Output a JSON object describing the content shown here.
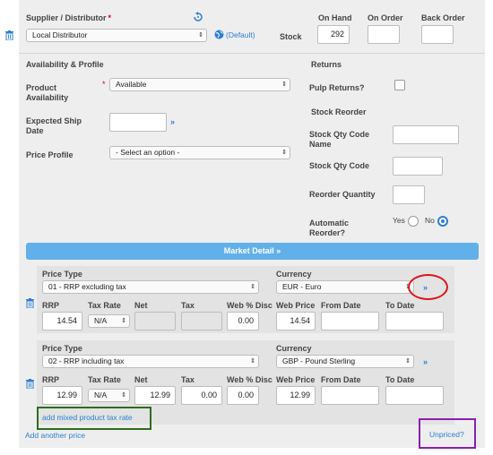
{
  "supplier": {
    "label": "Supplier / Distributor",
    "required_mark": "*",
    "value": "Local Distributor",
    "default_link": "(Default)",
    "stock_label": "Stock",
    "on_hand_label": "On Hand",
    "on_order_label": "On Order",
    "back_order_label": "Back Order",
    "on_hand_value": "292",
    "on_order_value": "",
    "back_order_value": ""
  },
  "availability": {
    "section_title": "Availability & Profile",
    "product_availability_label_1": "Product",
    "product_availability_label_2": "Availability",
    "required_mark": "*",
    "product_availability_value": "Available",
    "expected_ship_label_1": "Expected Ship",
    "expected_ship_label_2": "Date",
    "expected_ship_value": "",
    "price_profile_label": "Price Profile",
    "price_profile_value": "- Select an option -"
  },
  "returns": {
    "section_title": "Returns",
    "pulp_returns_label": "Pulp Returns?"
  },
  "stock_reorder": {
    "section_title": "Stock Reorder",
    "qty_code_name_label_1": "Stock Qty Code",
    "qty_code_name_label_2": "Name",
    "qty_code_label": "Stock Qty Code",
    "reorder_qty_label": "Reorder Quantity",
    "auto_reorder_label_1": "Automatic",
    "auto_reorder_label_2": "Reorder?",
    "yes_label": "Yes",
    "no_label": "No",
    "auto_reorder_value": "No"
  },
  "market_detail": {
    "label": "Market Detail",
    "chevron": "»"
  },
  "prices": [
    {
      "price_type_label": "Price Type",
      "price_type_value": "01 - RRP excluding tax",
      "currency_label": "Currency",
      "currency_value": "EUR - Euro",
      "rrp_label": "RRP",
      "tax_rate_label": "Tax Rate",
      "net_label": "Net",
      "tax_label": "Tax",
      "web_disc_label": "Web % Disc",
      "web_price_label": "Web Price",
      "from_date_label": "From Date",
      "to_date_label": "To Date",
      "rrp_value": "14.54",
      "tax_rate_value": "N/A",
      "net_value": "",
      "tax_value": "",
      "web_disc_value": "0.00",
      "web_price_value": "14.54",
      "from_date_value": "",
      "to_date_value": ""
    },
    {
      "price_type_label": "Price Type",
      "price_type_value": "02 - RRP including tax",
      "currency_label": "Currency",
      "currency_value": "GBP - Pound Sterling",
      "rrp_label": "RRP",
      "tax_rate_label": "Tax Rate",
      "net_label": "Net",
      "tax_label": "Tax",
      "web_disc_label": "Web % Disc",
      "web_price_label": "Web Price",
      "from_date_label": "From Date",
      "to_date_label": "To Date",
      "rrp_value": "12.99",
      "tax_rate_value": "N/A",
      "net_value": "12.99",
      "tax_value": "0.00",
      "web_disc_value": "0.00",
      "web_price_value": "12.99",
      "from_date_value": "",
      "to_date_value": ""
    }
  ],
  "links": {
    "add_mixed_tax": "add mixed product tax rate",
    "add_another_price": "Add another price",
    "unpriced": "Unpriced?"
  },
  "annotations": {
    "red_circle": "#e0141e",
    "green_box": "#2f6b1f",
    "purple_box": "#8a1fb0"
  },
  "colors": {
    "accent": "#2a7fd4",
    "market_bar": "#62b0ea",
    "panel": "#eeeeee",
    "subpanel": "#e3e3e3"
  }
}
